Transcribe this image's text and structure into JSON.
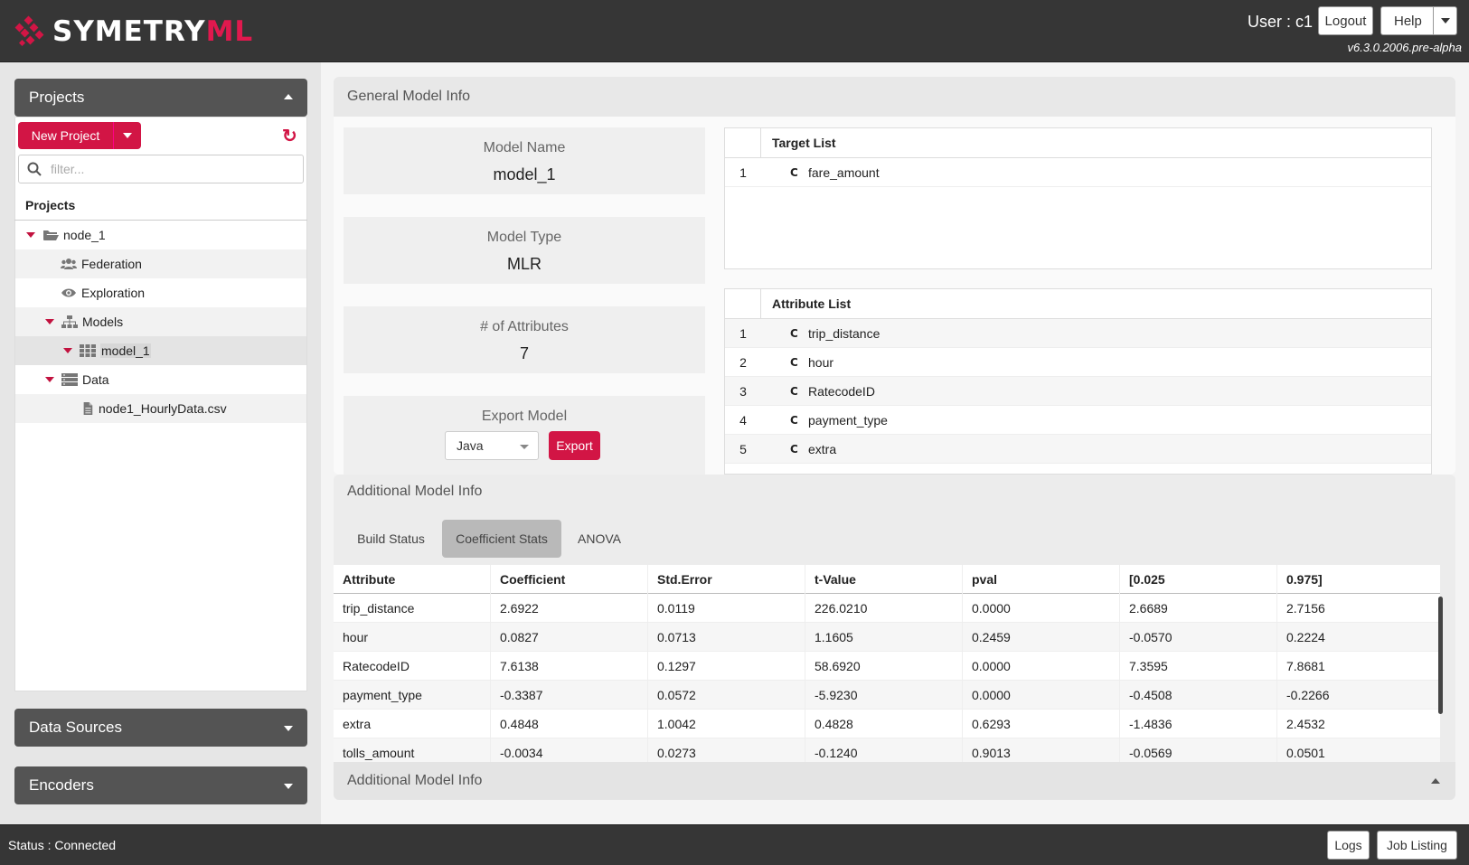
{
  "app": {
    "logo_main": "SYMETRY",
    "logo_accent": "ML",
    "user_label": "User : c1",
    "logout_label": "Logout",
    "help_label": "Help",
    "version": "v6.3.0.2006.pre-alpha",
    "accent_color": "#d21545"
  },
  "sidebar": {
    "projects_panel_title": "Projects",
    "new_project_label": "New Project",
    "filter_placeholder": "filter...",
    "projects_header": "Projects",
    "tree": {
      "root": "node_1",
      "federation": "Federation",
      "exploration": "Exploration",
      "models": "Models",
      "model_1": "model_1",
      "data": "Data",
      "csv": "node1_HourlyData.csv"
    },
    "data_sources_title": "Data Sources",
    "encoders_title": "Encoders"
  },
  "general": {
    "title": "General Model Info",
    "model_name_key": "Model Name",
    "model_name_value": "model_1",
    "model_type_key": "Model Type",
    "model_type_value": "MLR",
    "attributes_key": "# of Attributes",
    "attributes_value": "7",
    "export_key": "Export Model",
    "export_format": "Java",
    "export_button": "Export",
    "target_list_title": "Target List",
    "target_list": [
      {
        "n": "1",
        "type": "C",
        "name": "fare_amount"
      }
    ],
    "attribute_list_title": "Attribute List",
    "attribute_list": [
      {
        "n": "1",
        "type": "C",
        "name": "trip_distance"
      },
      {
        "n": "2",
        "type": "C",
        "name": "hour"
      },
      {
        "n": "3",
        "type": "C",
        "name": "RatecodeID"
      },
      {
        "n": "4",
        "type": "C",
        "name": "payment_type"
      },
      {
        "n": "5",
        "type": "C",
        "name": "extra"
      }
    ]
  },
  "additional": {
    "title": "Additional Model Info",
    "tabs": [
      "Build Status",
      "Coefficient Stats",
      "ANOVA"
    ],
    "active_tab": "Coefficient Stats",
    "columns": [
      "Attribute",
      "Coefficient",
      "Std.Error",
      "t-Value",
      "pval",
      "[0.025",
      "0.975]"
    ],
    "rows": [
      [
        "trip_distance",
        "2.6922",
        "0.0119",
        "226.0210",
        "0.0000",
        "2.6689",
        "2.7156"
      ],
      [
        "hour",
        "0.0827",
        "0.0713",
        "1.1605",
        "0.2459",
        "-0.0570",
        "0.2224"
      ],
      [
        "RatecodeID",
        "7.6138",
        "0.1297",
        "58.6920",
        "0.0000",
        "7.3595",
        "7.8681"
      ],
      [
        "payment_type",
        "-0.3387",
        "0.0572",
        "-5.9230",
        "0.0000",
        "-0.4508",
        "-0.2266"
      ],
      [
        "extra",
        "0.4848",
        "1.0042",
        "0.4828",
        "0.6293",
        "-1.4836",
        "2.4532"
      ],
      [
        "tolls_amount",
        "-0.0034",
        "0.0273",
        "-0.1240",
        "0.9013",
        "-0.0569",
        "0.0501"
      ]
    ],
    "footer_title": "Additional Model Info"
  },
  "status": {
    "text": "Status : Connected",
    "logs_label": "Logs",
    "job_listing_label": "Job Listing"
  }
}
